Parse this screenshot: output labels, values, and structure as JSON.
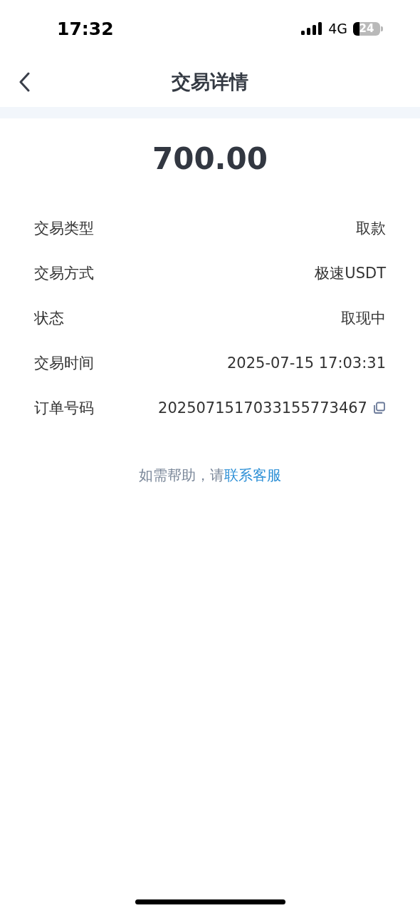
{
  "status_bar": {
    "time": "17:32",
    "network": "4G",
    "battery": "24"
  },
  "nav": {
    "title": "交易详情"
  },
  "amount": "700.00",
  "rows": [
    {
      "kind": "text",
      "label": "交易类型",
      "value": "取款"
    },
    {
      "kind": "text",
      "label": "交易方式",
      "value": "极速USDT"
    },
    {
      "kind": "text",
      "label": "状态",
      "value": "取现中"
    },
    {
      "kind": "text",
      "label": "交易时间",
      "value": "2025-07-15 17:03:31"
    },
    {
      "kind": "copy",
      "label": "订单号码",
      "value": "2025071517033155773467"
    }
  ],
  "help": {
    "text": "如需帮助，请",
    "link": "联系客服"
  }
}
